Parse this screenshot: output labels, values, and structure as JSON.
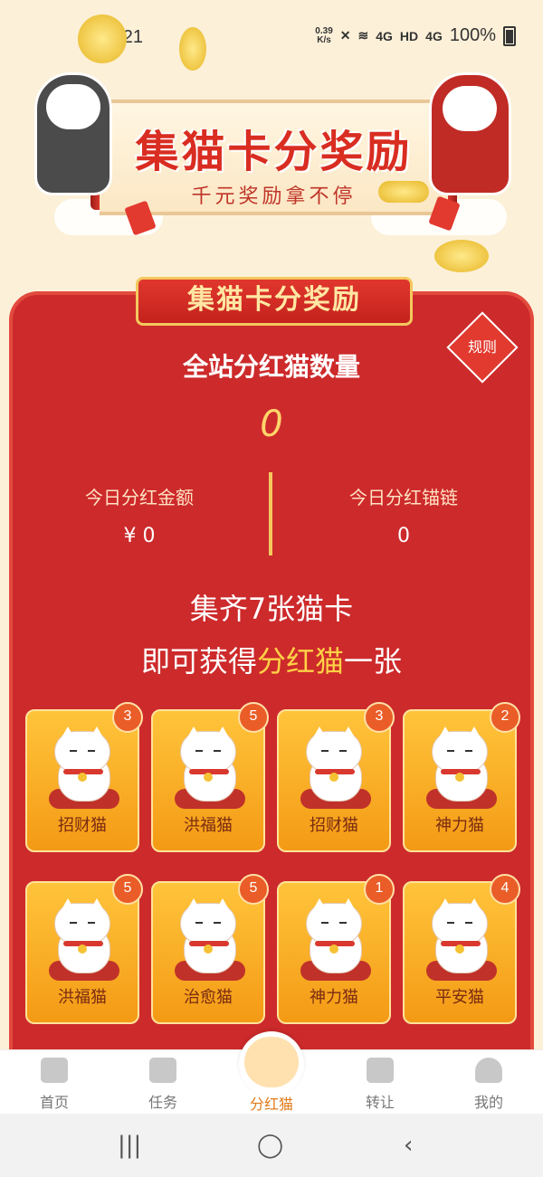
{
  "status_bar": {
    "time": "14:21",
    "net_speed_value": "0.39",
    "net_speed_unit": "K/s",
    "sim1": "4G",
    "hd": "HD",
    "sim2": "4G",
    "battery": "100%"
  },
  "banner": {
    "title": "集猫卡分奖励",
    "subtitle": "千元奖励拿不停"
  },
  "panel": {
    "ribbon_title": "集猫卡分奖励",
    "rules_label": "规则",
    "total_label": "全站分红猫数量",
    "total_value": "0",
    "today_amount_label": "今日分红金额",
    "today_amount_value": "¥ 0",
    "today_chain_label": "今日分红锚链",
    "today_chain_value": "0",
    "collect_line1": "集齐7张猫卡",
    "collect_line2_prefix": "即可获得",
    "collect_line2_highlight": "分红猫",
    "collect_line2_suffix": "一张"
  },
  "cards": [
    {
      "name": "招财猫",
      "count": "3"
    },
    {
      "name": "洪福猫",
      "count": "5"
    },
    {
      "name": "招财猫",
      "count": "3"
    },
    {
      "name": "神力猫",
      "count": "2"
    },
    {
      "name": "洪福猫",
      "count": "5"
    },
    {
      "name": "治愈猫",
      "count": "5"
    },
    {
      "name": "神力猫",
      "count": "1"
    },
    {
      "name": "平安猫",
      "count": "4"
    }
  ],
  "nav": {
    "home": "首页",
    "tasks": "任务",
    "dividend_cat": "分红猫",
    "transfer": "转让",
    "mine": "我的"
  },
  "colors": {
    "panel_red": "#cd2a2b",
    "card_gold": "#ffc43b",
    "highlight_yellow": "#ffd146",
    "active_nav": "#e07b1b"
  }
}
